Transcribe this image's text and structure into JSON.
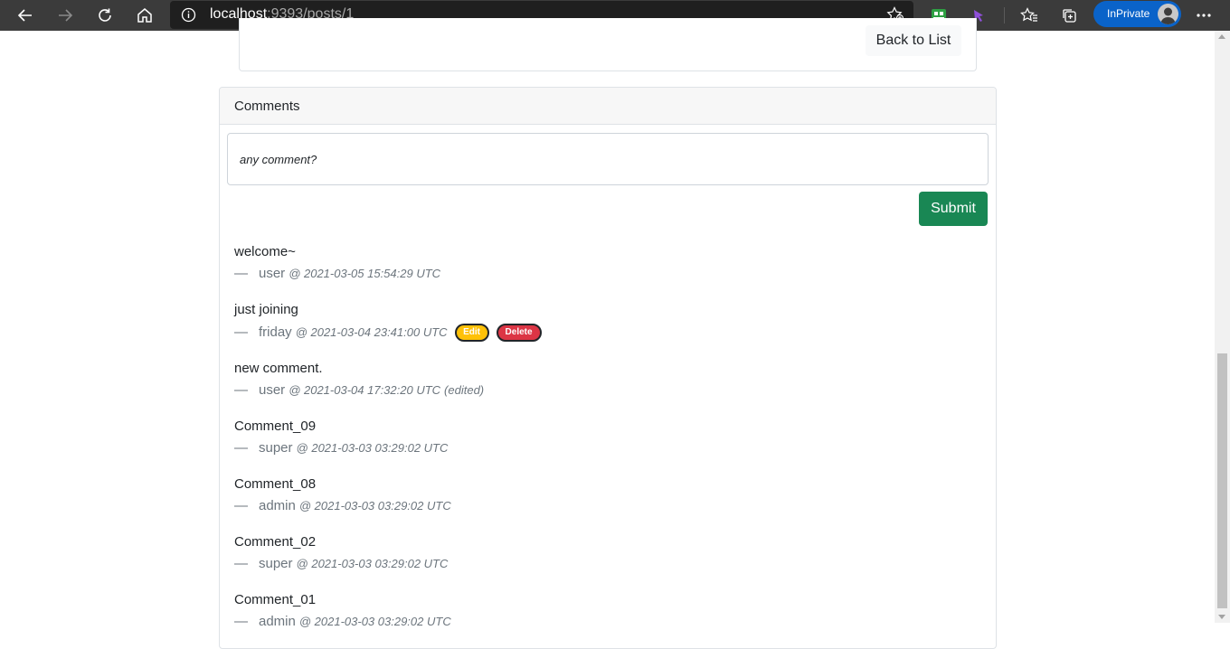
{
  "browser": {
    "url_host": "localhost",
    "url_rest": ":9393/posts/1",
    "inprivate_label": "InPrivate",
    "icons": [
      "back-arrow-icon",
      "forward-arrow-icon",
      "refresh-icon",
      "home-icon",
      "info-icon",
      "favorite-star-icon",
      "extension-icon",
      "extension-arrow-icon",
      "favorites-icon",
      "collections-icon",
      "profile-avatar-icon",
      "more-icon"
    ]
  },
  "post": {
    "back_label": "Back to List"
  },
  "comments": {
    "header": "Comments",
    "input_placeholder": "any comment?",
    "submit_label": "Submit",
    "dash": "—",
    "items": [
      {
        "text": "welcome~",
        "author": "user",
        "timestamp": "@ 2021-03-05 15:54:29 UTC"
      },
      {
        "text": "just joining",
        "author": "friday",
        "timestamp": "@ 2021-03-04 23:41:00 UTC",
        "edit_label": "Edit",
        "delete_label": "Delete"
      },
      {
        "text": "new comment.",
        "author": "user",
        "timestamp": "@ 2021-03-04 17:32:20 UTC",
        "edited_label": "(edited)"
      },
      {
        "text": "Comment_09",
        "author": "super",
        "timestamp": "@ 2021-03-03 03:29:02 UTC"
      },
      {
        "text": "Comment_08",
        "author": "admin",
        "timestamp": "@ 2021-03-03 03:29:02 UTC"
      },
      {
        "text": "Comment_02",
        "author": "super",
        "timestamp": "@ 2021-03-03 03:29:02 UTC"
      },
      {
        "text": "Comment_01",
        "author": "admin",
        "timestamp": "@ 2021-03-03 03:29:02 UTC"
      }
    ]
  },
  "colors": {
    "submit": "#198754",
    "edit": "#ffc107",
    "delete": "#dc3545",
    "inprivate": "#0a63c9"
  }
}
